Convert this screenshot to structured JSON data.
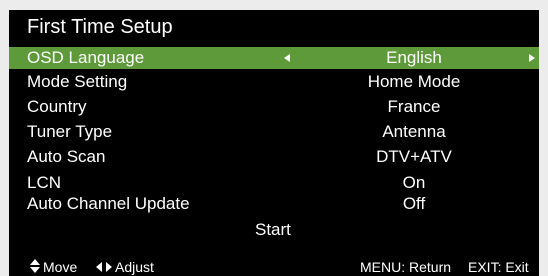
{
  "title": "First Time Setup",
  "settings": [
    {
      "label": "OSD Language",
      "value": "English"
    },
    {
      "label": "Mode Setting",
      "value": "Home Mode"
    },
    {
      "label": "Country",
      "value": "France"
    },
    {
      "label": "Tuner Type",
      "value": "Antenna"
    },
    {
      "label": "Auto Scan",
      "value": "DTV+ATV"
    },
    {
      "label": "LCN",
      "value": "On"
    },
    {
      "label": "Auto Channel Update",
      "value": "Off"
    }
  ],
  "start_label": "Start",
  "footer": {
    "move": "Move",
    "adjust": "Adjust",
    "menu": "MENU: Return",
    "exit": "EXIT: Exit"
  },
  "colors": {
    "background": "#000000",
    "highlight": "#5f9a3a",
    "text": "#ffffff"
  },
  "icons": [
    "left-arrow-icon",
    "right-arrow-icon",
    "up-down-arrow-icon",
    "left-right-arrow-icon"
  ]
}
